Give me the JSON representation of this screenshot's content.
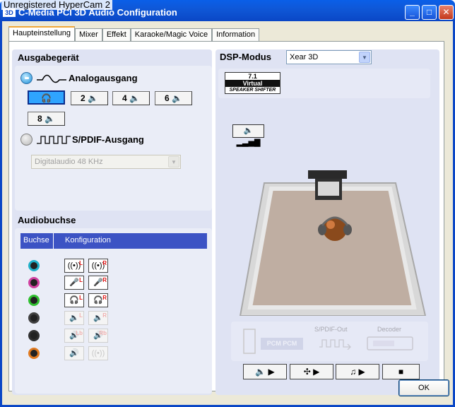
{
  "watermark": "Unregistered HyperCam 2",
  "window": {
    "title": "C-Media PCI 3D Audio Configuration",
    "icon_text": "3D",
    "controls": {
      "minimize": "_",
      "maximize": "□",
      "close": "✕"
    }
  },
  "tabs": [
    {
      "label": "Haupteinstellung",
      "active": true
    },
    {
      "label": "Mixer"
    },
    {
      "label": "Effekt"
    },
    {
      "label": "Karaoke/Magic Voice"
    },
    {
      "label": "Information"
    }
  ],
  "output": {
    "heading": "Ausgabegerät",
    "analog_label": "Analogausgang",
    "speaker_buttons": [
      "🎧",
      "2 🔈",
      "4 🔈",
      "6 🔈",
      "8 🔈"
    ],
    "spdif_label": "S/PDIF-Ausgang",
    "spdif_select": "Digitalaudio  48 KHz"
  },
  "audiobuchse": {
    "heading": "Audiobuchse",
    "col1": "Buchse",
    "col2": "Konfiguration",
    "jack_colors": [
      "#20b0c8",
      "#d040a0",
      "#30c030",
      "#404040",
      "#303030",
      "#e07a20"
    ],
    "rows": [
      {
        "a": "((•))",
        "a_tag": "L",
        "b": "((•))",
        "b_tag": "R",
        "dim": false
      },
      {
        "a": "🎤",
        "a_tag": "L",
        "b": "🎤",
        "b_tag": "R",
        "dim": false
      },
      {
        "a": "🎧",
        "a_tag": "L",
        "b": "🎧",
        "b_tag": "R",
        "dim": false
      },
      {
        "a": "🔈",
        "a_tag": "L",
        "b": "🔈",
        "b_tag": "R",
        "dim": true
      },
      {
        "a": "🔊",
        "a_tag": "Lb",
        "b": "🔊",
        "b_tag": "Rb",
        "dim": true
      },
      {
        "a": "🔊",
        "a_tag": "",
        "b": "((•))",
        "b_tag": "",
        "dim": true
      }
    ]
  },
  "dsp": {
    "label": "DSP-Modus",
    "mode": "Xear 3D",
    "badge_top": "7.1",
    "badge_mid": "Virtual",
    "badge_bottom": "SPEAKER SHIFTER",
    "volume_icon": "🔈▂▃▅▇",
    "spdif_out": "S/PDIF-Out",
    "decoder": "Decoder",
    "pcm_label": "PCM PCM"
  },
  "bottom_buttons": [
    "🔈 ▶",
    "✣ ▶",
    "♫ ▶",
    "■"
  ],
  "ok": "OK"
}
